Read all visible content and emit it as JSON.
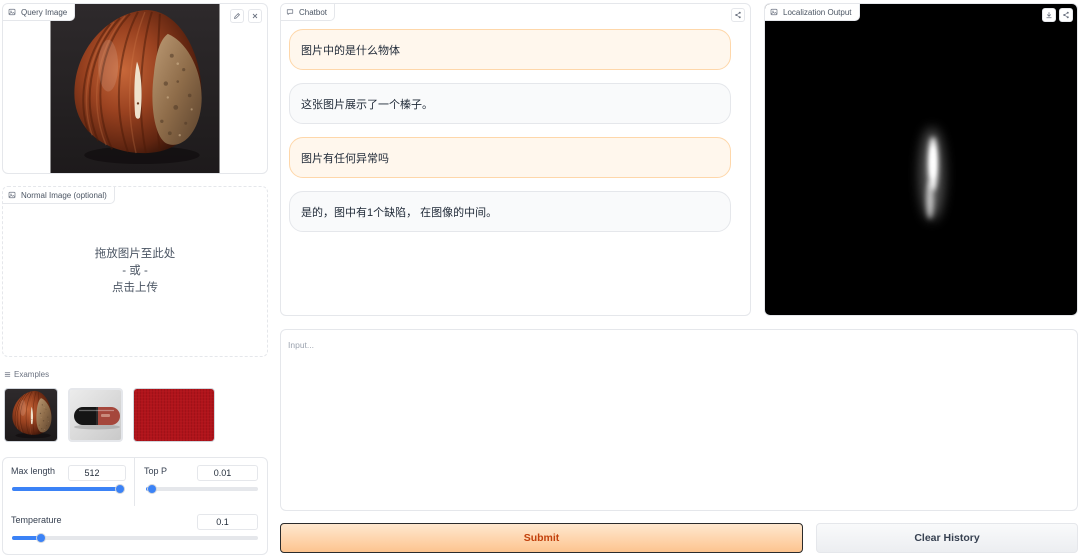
{
  "colors": {
    "slider": "#3b82f6",
    "user_bubble": "#fff7ed",
    "user_border": "#fed7aa",
    "bot_bubble": "#f9fafb",
    "bot_border": "#e5e7eb",
    "submit_text": "#c2410c",
    "localization_bg": "#000000"
  },
  "query_image": {
    "label": "Query Image",
    "label_icon": "image-icon",
    "action_icons": [
      "edit-icon",
      "close-icon"
    ]
  },
  "normal_image": {
    "label": "Normal Image (optional)",
    "label_icon": "image-icon",
    "drop_text": "拖放图片至此处",
    "or_text": "- 或 -",
    "upload_text": "点击上传"
  },
  "examples": {
    "label": "Examples",
    "label_icon": "list-icon"
  },
  "params": {
    "max_length": {
      "label": "Max length",
      "value": 512,
      "slider_fraction": 1.0
    },
    "top_p": {
      "label": "Top P",
      "value": 0.01,
      "slider_fraction": 0.01
    },
    "temperature": {
      "label": "Temperature",
      "value": 0.1,
      "slider_fraction": 0.1
    }
  },
  "chatbot": {
    "label": "Chatbot",
    "label_icon": "chat-icon",
    "action_icons": [
      "share-icon"
    ],
    "messages": [
      {
        "is_user": true,
        "text": "图片中的是什么物体"
      },
      {
        "is_user": false,
        "text": "这张图片展示了一个榛子。"
      },
      {
        "is_user": true,
        "text": "图片有任何异常吗"
      },
      {
        "is_user": false,
        "text": "是的，图中有1个缺陷， 在图像的中间。"
      }
    ]
  },
  "localization": {
    "label": "Localization Output",
    "label_icon": "image-icon",
    "action_icons": [
      "download-icon",
      "share-icon"
    ]
  },
  "input": {
    "placeholder": "Input..."
  },
  "buttons": {
    "submit": "Submit",
    "clear_history": "Clear History"
  }
}
